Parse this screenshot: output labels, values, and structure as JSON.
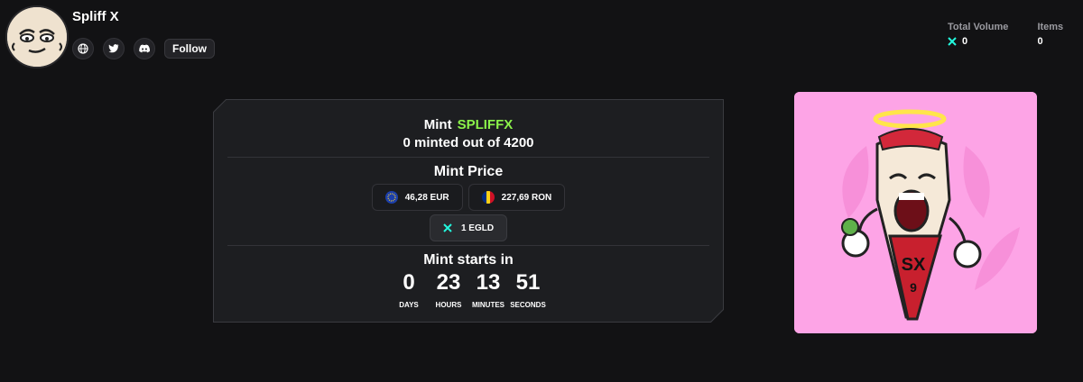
{
  "collection": {
    "name": "Spliff X",
    "follow_label": "Follow"
  },
  "social": {
    "icons": [
      "globe-icon",
      "twitter-icon",
      "discord-icon"
    ]
  },
  "stats": {
    "total_volume_label": "Total Volume",
    "total_volume_value": "0",
    "items_label": "Items",
    "items_value": "0"
  },
  "mint": {
    "title": "Mint",
    "ticker": "SPLIFFX",
    "minted_text": "0 minted out of 4200",
    "price_title": "Mint Price",
    "price_eur": "46,28 EUR",
    "price_ron": "227,69 RON",
    "price_egld": "1 EGLD",
    "starts_title": "Mint starts in",
    "countdown": {
      "days": "0",
      "days_label": "DAYS",
      "hours": "23",
      "hours_label": "HOURS",
      "minutes": "13",
      "minutes_label": "MINUTES",
      "seconds": "51",
      "seconds_label": "SECONDS"
    }
  },
  "colors": {
    "background": "#121214",
    "panel": "#1d1e21",
    "ticker": "#8bf24a",
    "egld_accent": "#23f7dd",
    "nft_background": "#fda4e6"
  }
}
